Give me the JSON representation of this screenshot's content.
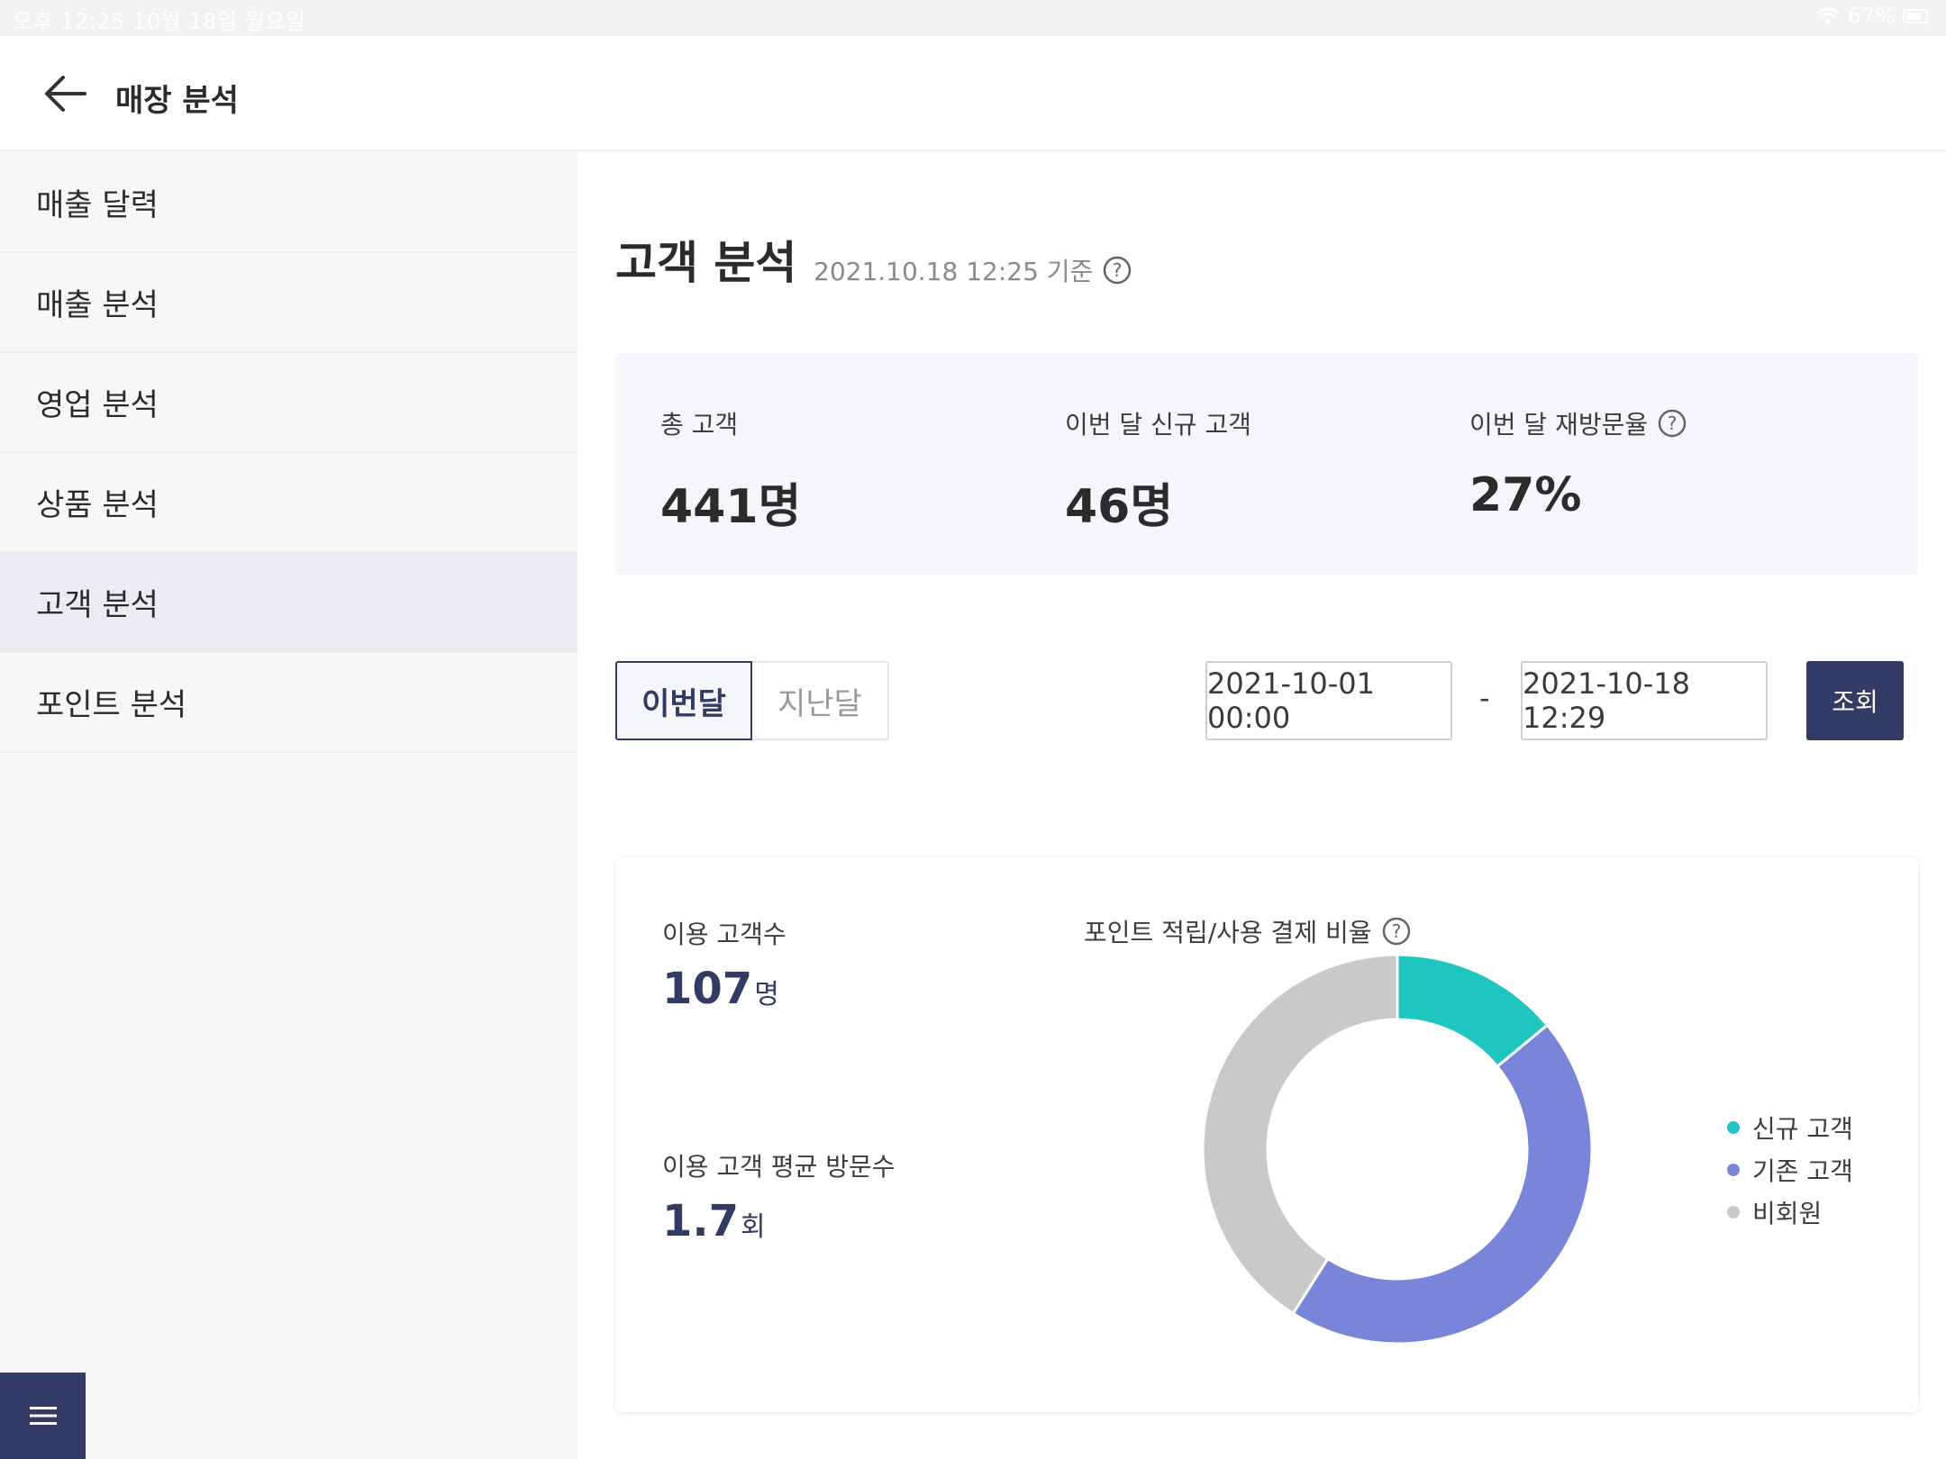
{
  "status_bar": {
    "time_date": "오후 12:25   10월 18일 월요일",
    "battery": "67%"
  },
  "header": {
    "title": "매장 분석"
  },
  "sidebar": {
    "items": [
      {
        "label": "매출 달력"
      },
      {
        "label": "매출 분석"
      },
      {
        "label": "영업 분석"
      },
      {
        "label": "상품 분석"
      },
      {
        "label": "고객 분석"
      },
      {
        "label": "포인트 분석"
      }
    ],
    "active_index": 4
  },
  "main": {
    "title": "고객 분석",
    "timestamp": "2021.10.18 12:25 기준"
  },
  "summary": {
    "total_customers": {
      "label": "총 고객",
      "value": "441명"
    },
    "new_customers": {
      "label": "이번 달 신규 고객",
      "value": "46명"
    },
    "revisit_rate": {
      "label": "이번 달 재방문율",
      "value": "27%"
    }
  },
  "period": {
    "this_month": "이번달",
    "last_month": "지난달",
    "selected": "이번달"
  },
  "date_range": {
    "start": "2021-10-01 00:00",
    "dash": "-",
    "end": "2021-10-18 12:29",
    "search_label": "조회"
  },
  "stats": {
    "users": {
      "label": "이용 고객수",
      "value": "107",
      "unit": "명"
    },
    "avg_visits": {
      "label": "이용 고객 평균 방문수",
      "value": "1.7",
      "unit": "회"
    }
  },
  "chart_data": {
    "type": "pie",
    "title": "포인트 적립/사용 결제 비율",
    "style": "donut",
    "categories": [
      "신규 고객",
      "기존 고객",
      "비회원"
    ],
    "values": [
      14,
      45,
      41
    ],
    "colors": [
      "#1fc6c0",
      "#7885d8",
      "#c9c9c9"
    ],
    "legend_position": "right"
  },
  "colors": {
    "primary": "#323b63",
    "sidebar_bg": "#f7f7f7",
    "sidebar_active": "#ebebf3",
    "summary_bg": "#f5f6fb"
  }
}
